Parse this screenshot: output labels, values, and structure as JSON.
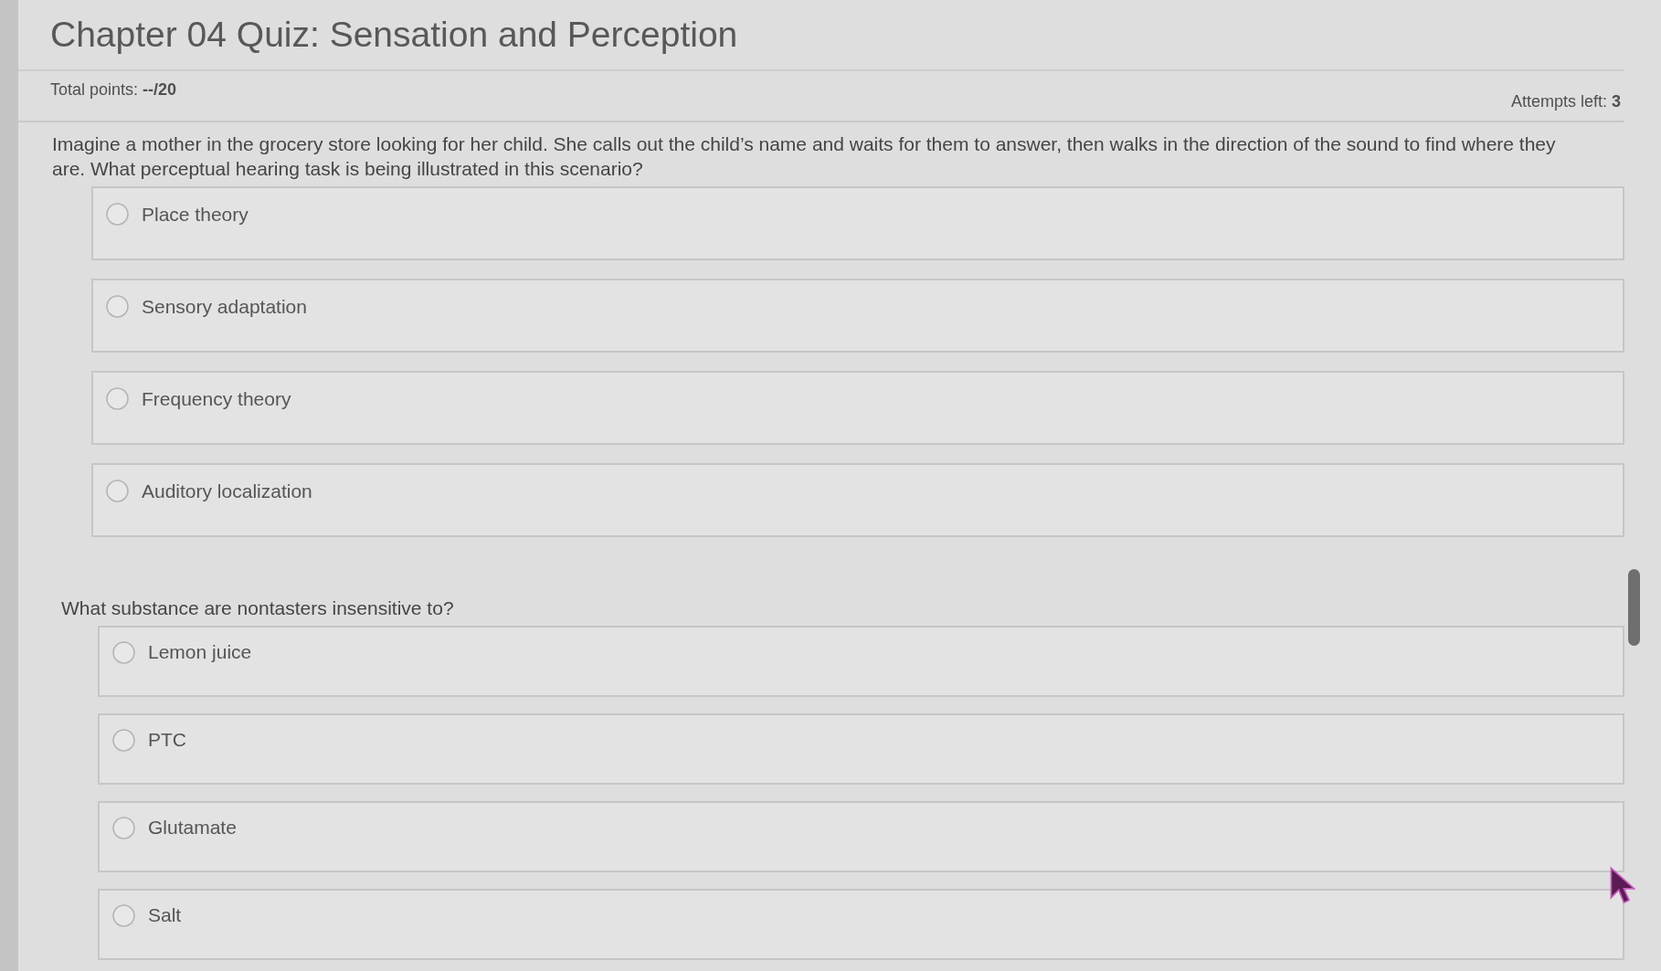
{
  "quiz": {
    "title": "Chapter 04 Quiz: Sensation and Perception",
    "total_points": "Total points: **--/20**",
    "attempts_left": "Attempts left: **3**"
  },
  "questions": [
    {
      "prompt": "Imagine a mother in the grocery store looking for her child. She calls out the child’s name and waits for them to answer, then walks in the direction of the sound to find where they are. What perceptual hearing task is being illustrated in this scenario?",
      "options": [
        {
          "label": "Place theory",
          "selected": false
        },
        {
          "label": "Sensory adaptation",
          "selected": false
        },
        {
          "label": "Frequency theory",
          "selected": false
        },
        {
          "label": "Auditory localization",
          "selected": false
        }
      ]
    },
    {
      "prompt": "What substance are nontasters insensitive to?",
      "options": [
        {
          "label": "Lemon juice",
          "selected": false
        },
        {
          "label": "PTC",
          "selected": false
        },
        {
          "label": "Glutamate",
          "selected": false
        },
        {
          "label": "Salt",
          "selected": false
        }
      ]
    }
  ]
}
